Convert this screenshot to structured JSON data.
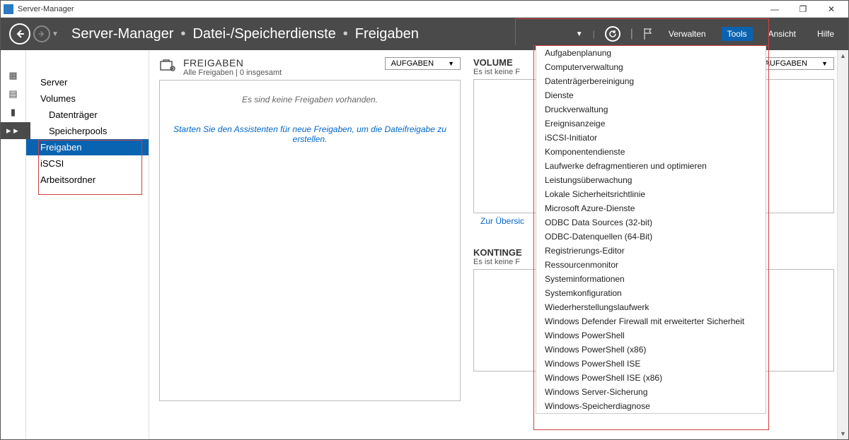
{
  "window": {
    "title": "Server-Manager",
    "min": "—",
    "max": "❐",
    "close": "✕"
  },
  "header": {
    "breadcrumb": [
      "Server-Manager",
      "Datei-/Speicherdienste",
      "Freigaben"
    ],
    "menu": {
      "verwalten": "Verwalten",
      "tools": "Tools",
      "ansicht": "Ansicht",
      "hilfe": "Hilfe"
    }
  },
  "iconbar": [
    "▦",
    "▤",
    "▮",
    "▸ ▸"
  ],
  "nav": {
    "server": "Server",
    "volumes": "Volumes",
    "datentraeger": "Datenträger",
    "speicherpools": "Speicherpools",
    "freigaben": "Freigaben",
    "iscsi": "iSCSI",
    "arbeitsordner": "Arbeitsordner"
  },
  "shares": {
    "title": "FREIGABEN",
    "subtitle": "Alle Freigaben | 0 insgesamt",
    "tasks": "AUFGABEN",
    "empty": "Es sind keine Freigaben vorhanden.",
    "link": "Starten Sie den Assistenten für neue Freigaben, um die Dateifreigabe zu erstellen."
  },
  "volume": {
    "title": "VOLUME",
    "subtitle": "Es ist keine F",
    "tasks": "AUFGABEN",
    "overview": "Zur Übersic"
  },
  "quota": {
    "title": "KONTINGE",
    "subtitle": "Es ist keine F"
  },
  "tools_menu": [
    "Aufgabenplanung",
    "Computerverwaltung",
    "Datenträgerbereinigung",
    "Dienste",
    "Druckverwaltung",
    "Ereignisanzeige",
    "iSCSI-Initiator",
    "Komponentendienste",
    "Laufwerke defragmentieren und optimieren",
    "Leistungsüberwachung",
    "Lokale Sicherheitsrichtlinie",
    "Microsoft Azure-Dienste",
    "ODBC Data Sources (32-bit)",
    "ODBC-Datenquellen (64-Bit)",
    "Registrierungs-Editor",
    "Ressourcenmonitor",
    "Systeminformationen",
    "Systemkonfiguration",
    "Wiederherstellungslaufwerk",
    "Windows Defender Firewall mit erweiterter Sicherheit",
    "Windows PowerShell",
    "Windows PowerShell (x86)",
    "Windows PowerShell ISE",
    "Windows PowerShell ISE (x86)",
    "Windows Server-Sicherung",
    "Windows-Speicherdiagnose"
  ]
}
